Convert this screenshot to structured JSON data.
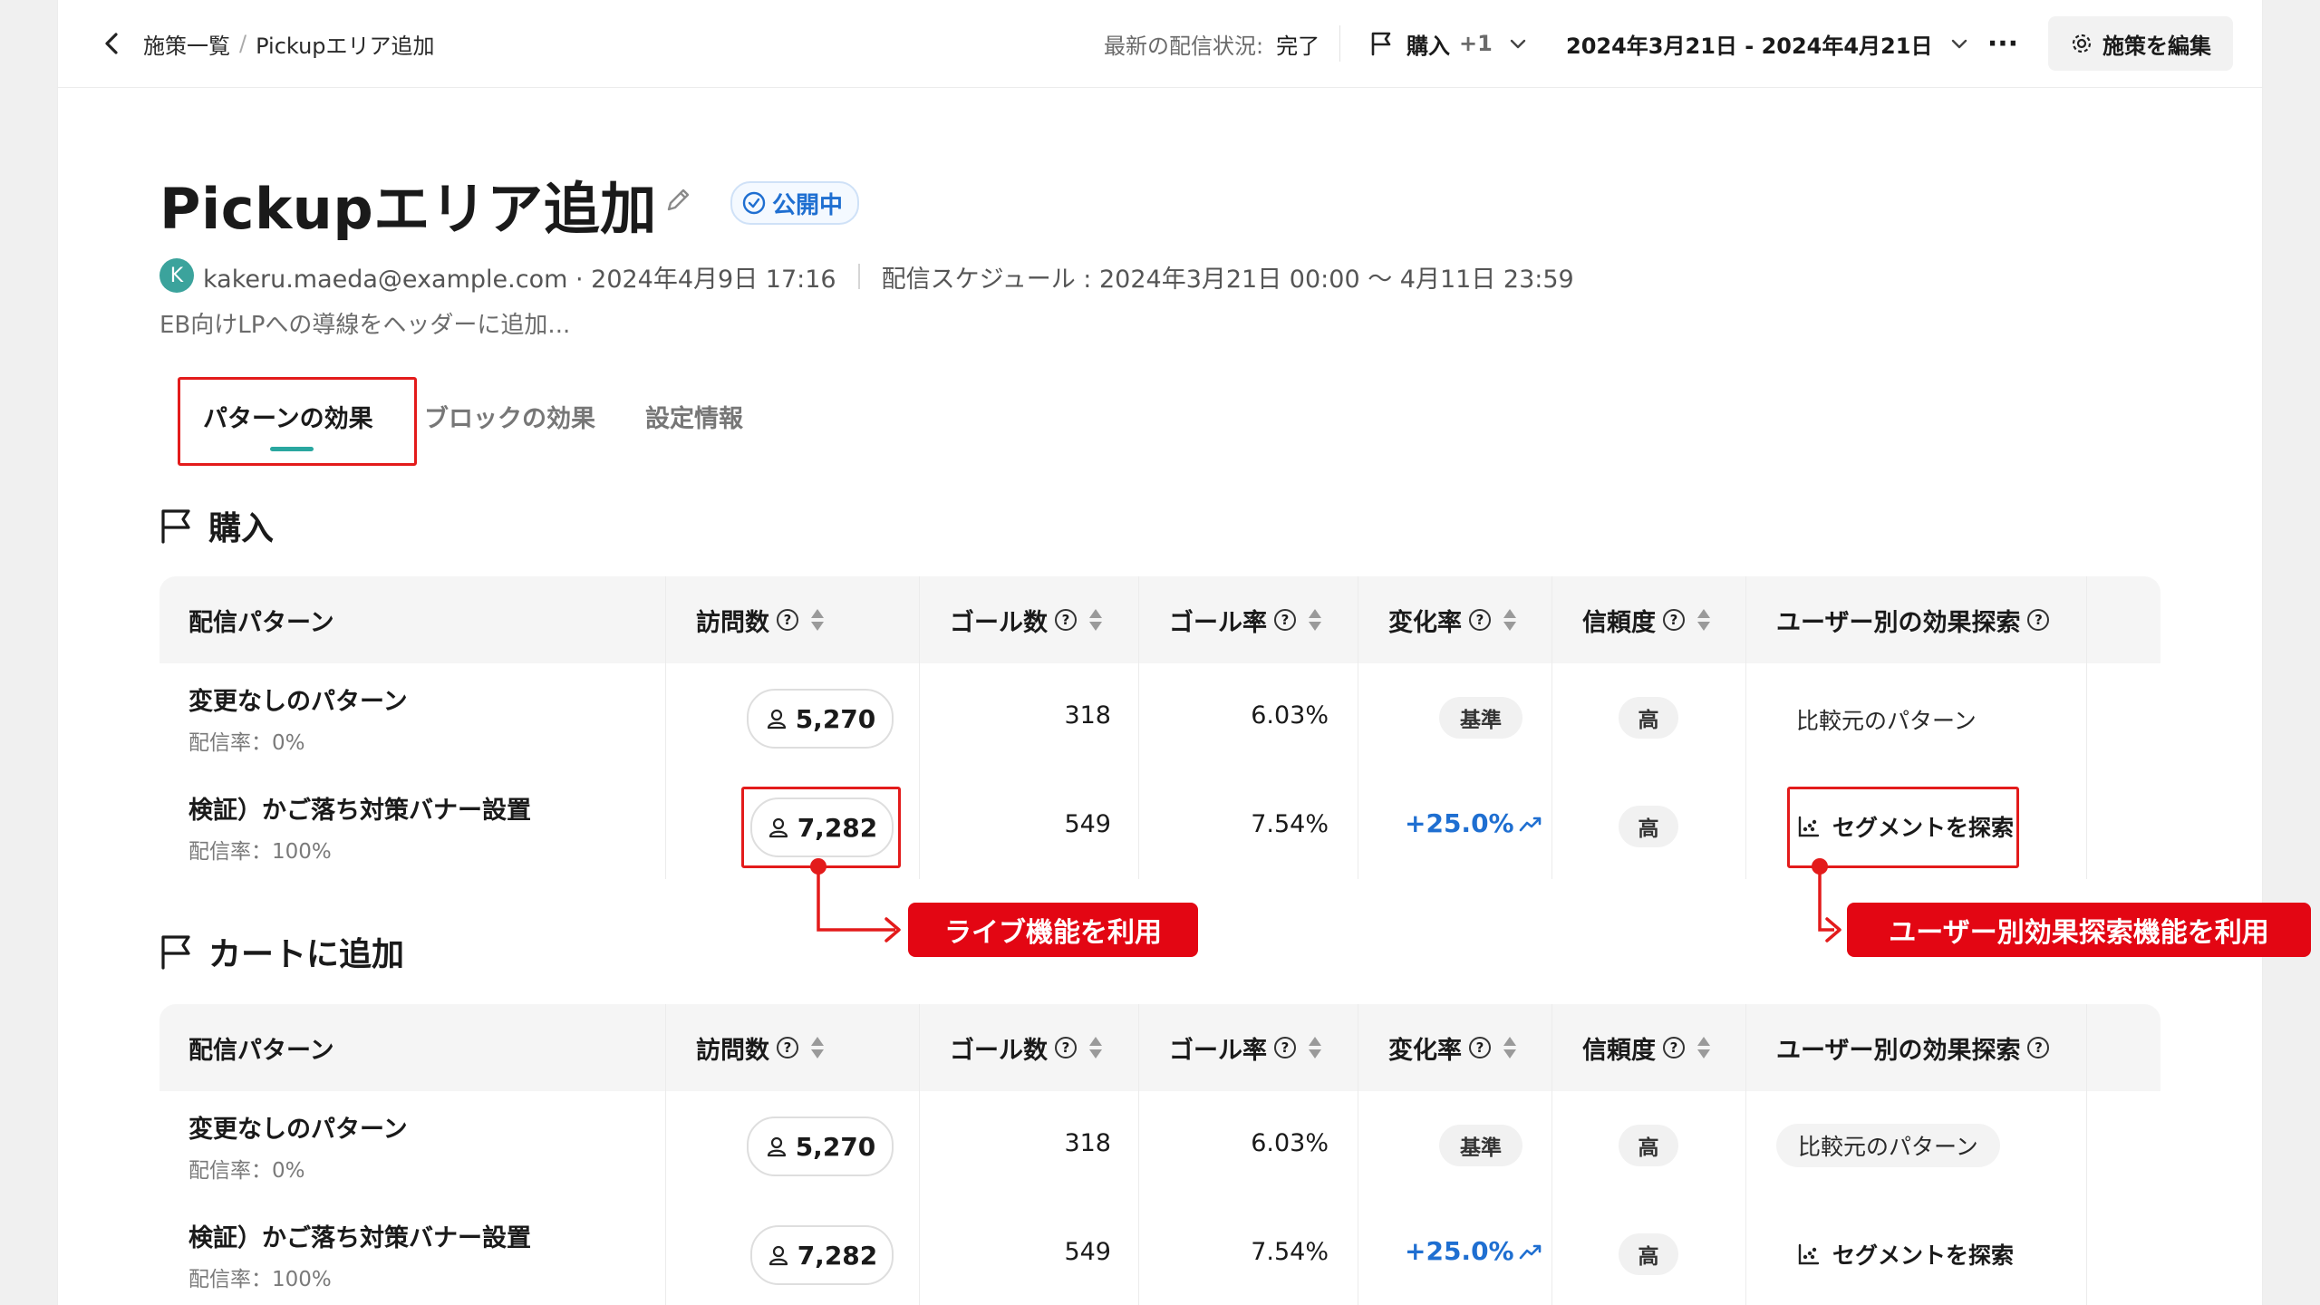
{
  "header": {
    "breadcrumb_parent": "施策一覧",
    "breadcrumb_sep": "/",
    "breadcrumb_current": "Pickupエリア追加",
    "status_label": "最新の配信状況:",
    "status_value": "完了",
    "goal_label": "購入",
    "goal_extra": "+1",
    "date_range": "2024年3月21日 - 2024年4月21日",
    "more_label": "···",
    "edit_label": "施策を編集"
  },
  "campaign": {
    "title": "Pickupエリア追加",
    "badge": "公開中",
    "avatar_initial": "K",
    "author_line": "kakeru.maeda@example.com · 2024年4月9日 17:16",
    "schedule": "配信スケジュール : 2024年3月21日 00:00 〜 4月11日 23:59",
    "description": "EB向けLPへの導線をヘッダーに追加..."
  },
  "tabs": [
    "パターンの効果",
    "ブロックの効果",
    "設定情報"
  ],
  "columns": [
    "配信パターン",
    "訪問数",
    "ゴール数",
    "ゴール率",
    "変化率",
    "信頼度",
    "ユーザー別の効果探索"
  ],
  "sections": [
    {
      "title": "購入",
      "rows": [
        {
          "name": "変更なしのパターン",
          "rate": "配信率：0%",
          "visits": "5,270",
          "goals": "318",
          "goal_rate": "6.03%",
          "change": "基準",
          "confidence": "高",
          "explore": "比較元のパターン"
        },
        {
          "name": "検証）かご落ち対策バナー設置",
          "rate": "配信率：100%",
          "visits": "7,282",
          "goals": "549",
          "goal_rate": "7.54%",
          "change": "+25.0%",
          "confidence": "高",
          "explore": "セグメントを探索"
        }
      ]
    },
    {
      "title": "カートに追加",
      "rows": [
        {
          "name": "変更なしのパターン",
          "rate": "配信率：0%",
          "visits": "5,270",
          "goals": "318",
          "goal_rate": "6.03%",
          "change": "基準",
          "confidence": "高",
          "explore": "比較元のパターン"
        },
        {
          "name": "検証）かご落ち対策バナー設置",
          "rate": "配信率：100%",
          "visits": "7,282",
          "goals": "549",
          "goal_rate": "7.54%",
          "change": "+25.0%",
          "confidence": "高",
          "explore": "セグメントを探索"
        }
      ]
    }
  ],
  "annotations": {
    "live_label": "ライブ機能を利用",
    "segment_label": "ユーザー別効果探索機能を利用"
  },
  "colors": {
    "accent_teal": "#2aa7a0",
    "link_blue": "#1f6fd1",
    "annotation_red": "#e30613"
  }
}
